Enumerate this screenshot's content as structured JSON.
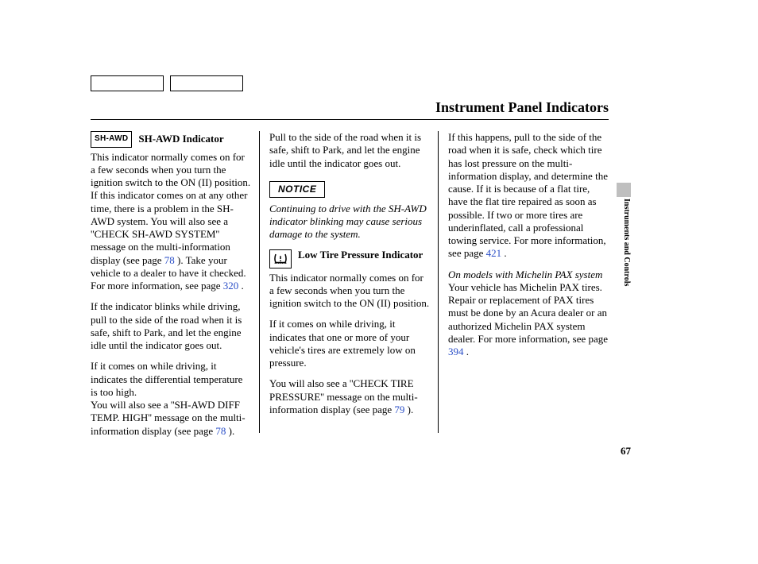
{
  "page_title": "Instrument Panel Indicators",
  "section_tab": "Instruments and Controls",
  "page_number": "67",
  "link_pages": {
    "p78": "78",
    "p79": "79",
    "p320": "320",
    "p394": "394",
    "p421": "421"
  },
  "col1": {
    "icon_label": "SH-AWD",
    "heading": "SH-AWD Indicator",
    "para1_a": "This indicator normally comes on for a few seconds when you turn the ignition switch to the ON (II) position. If this indicator comes on at any other time, there is a problem in the SH-AWD system. You will also see a ''CHECK SH-AWD SYSTEM'' message on the multi-information display (see page ",
    "para1_b": " ). Take your vehicle to a dealer to have it checked. For more information, see page ",
    "para1_c": " .",
    "para2": "If the indicator blinks while driving, pull to the side of the road when it is safe, shift to Park, and let the engine idle until the indicator goes out.",
    "para3": "If it comes on while driving, it indicates the differential temperature is too high.",
    "para4_a": "You will also see a ''SH-AWD DIFF TEMP. HIGH'' message on the multi-information display (see page ",
    "para4_b": " )."
  },
  "col2": {
    "para1": "Pull to the side of the road when it is safe, shift to Park, and let the engine idle until the indicator goes out.",
    "notice_label": "NOTICE",
    "notice_text": "Continuing to drive with the SH-AWD indicator blinking may cause serious damage to the system.",
    "heading": "Low Tire Pressure Indicator",
    "para2": "This indicator normally comes on for a few seconds when you turn the ignition switch to the ON (II) position.",
    "para3": "If it comes on while driving, it indicates that one or more of your vehicle's tires are extremely low on pressure.",
    "para4_a": "You will also see a ''CHECK TIRE PRESSURE'' message on the multi-information display (see page ",
    "para4_b": " )."
  },
  "col3": {
    "para1_a": "If this happens, pull to the side of the road when it is safe, check which tire has lost pressure on the multi-information display, and determine the cause. If it is because of a flat tire, have the flat tire repaired as soon as possible. If two or more tires are underinflated, call a professional towing service. For more information, see page ",
    "para1_b": " .",
    "subhead": "On models with Michelin PAX system",
    "para2_a": "Your vehicle has Michelin PAX tires. Repair or replacement of PAX tires must be done by an Acura dealer or an authorized Michelin PAX system dealer. For more information, see page ",
    "para2_b": " ."
  }
}
